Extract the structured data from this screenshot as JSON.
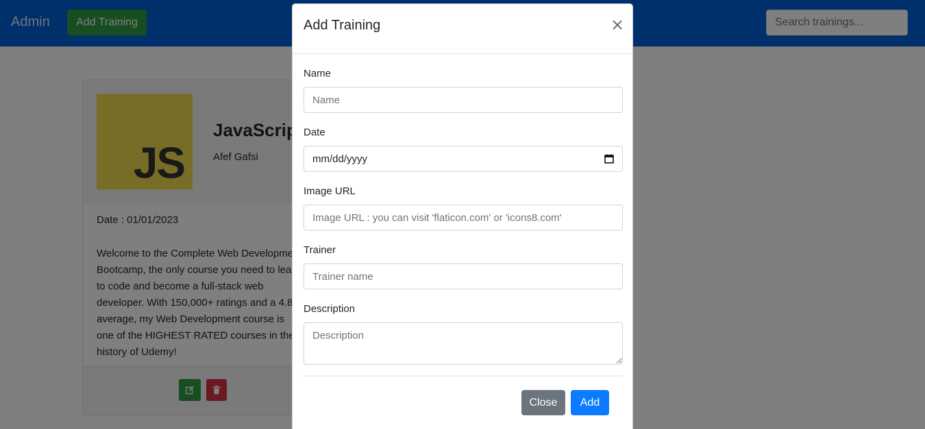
{
  "navbar": {
    "brand": "Admin",
    "add_button": "Add Training",
    "search_placeholder": "Search trainings..."
  },
  "card": {
    "logo_text": "JS",
    "title": "JavaScript",
    "trainer": "Afef Gafsi",
    "date": "Date : 01/01/2023",
    "description": "Welcome to the Complete Web Development Bootcamp, the only course you need to learn to code and become a full-stack web developer. With 150,000+ ratings and a 4.8 average, my Web Development course is one of the HIGHEST RATED courses in the history of Udemy!"
  },
  "modal": {
    "title": "Add Training",
    "close_icon": "×",
    "fields": {
      "name_label": "Name",
      "name_placeholder": "Name",
      "date_label": "Date",
      "date_placeholder": "mm/dd/yyyy",
      "image_label": "Image URL",
      "image_placeholder": "Image URL : you can visit 'flaticon.com' or 'icons8.com'",
      "trainer_label": "Trainer",
      "trainer_placeholder": "Trainer name",
      "description_label": "Description",
      "description_placeholder": "Description"
    },
    "close_button": "Close",
    "add_button": "Add"
  },
  "colors": {
    "navbar": "#0060d8",
    "success": "#2e9a43",
    "danger": "#d43145",
    "primary": "#0d7bff",
    "secondary": "#6c757d",
    "js_yellow": "#f0db4f"
  }
}
